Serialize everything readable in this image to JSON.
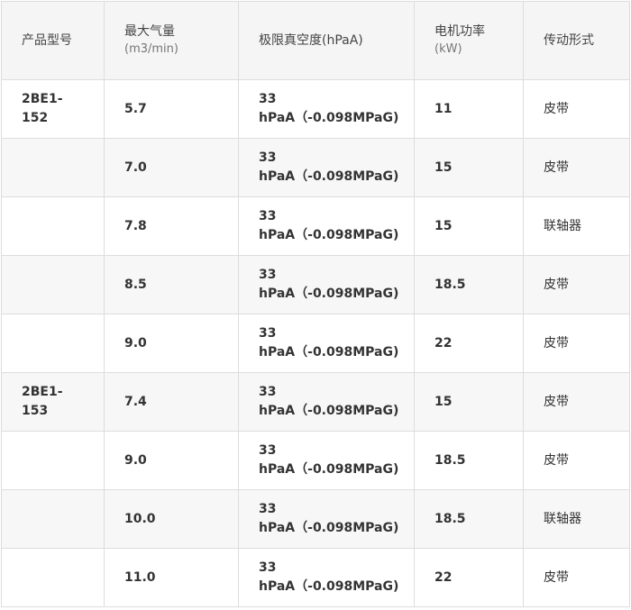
{
  "headers": {
    "model": "产品型号",
    "airflow": "最大气量",
    "airflow_unit": "(m3/min)",
    "vacuum": "极限真空度(hPaA)",
    "power": "电机功率",
    "power_unit": "(kW)",
    "drive": "传动形式"
  },
  "rows": [
    {
      "model": "2BE1-152",
      "airflow": "5.7",
      "vacuum_1": "33",
      "vacuum_2": "hPaA（-0.098MPaG)",
      "power": "11",
      "drive": "皮带"
    },
    {
      "model": "",
      "airflow": "7.0",
      "vacuum_1": "33",
      "vacuum_2": "hPaA（-0.098MPaG)",
      "power": "15",
      "drive": "皮带"
    },
    {
      "model": "",
      "airflow": "7.8",
      "vacuum_1": "33",
      "vacuum_2": "hPaA（-0.098MPaG)",
      "power": "15",
      "drive": "联轴器"
    },
    {
      "model": "",
      "airflow": "8.5",
      "vacuum_1": "33",
      "vacuum_2": "hPaA（-0.098MPaG)",
      "power": "18.5",
      "drive": "皮带"
    },
    {
      "model": "",
      "airflow": "9.0",
      "vacuum_1": "33",
      "vacuum_2": "hPaA（-0.098MPaG)",
      "power": "22",
      "drive": "皮带"
    },
    {
      "model": "2BE1-153",
      "airflow": "7.4",
      "vacuum_1": "33",
      "vacuum_2": "hPaA（-0.098MPaG)",
      "power": "15",
      "drive": "皮带"
    },
    {
      "model": "",
      "airflow": "9.0",
      "vacuum_1": "33",
      "vacuum_2": "hPaA（-0.098MPaG)",
      "power": "18.5",
      "drive": "皮带"
    },
    {
      "model": "",
      "airflow": "10.0",
      "vacuum_1": "33",
      "vacuum_2": "hPaA（-0.098MPaG)",
      "power": "18.5",
      "drive": "联轴器"
    },
    {
      "model": "",
      "airflow": "11.0",
      "vacuum_1": "33",
      "vacuum_2": "hPaA（-0.098MPaG)",
      "power": "22",
      "drive": "皮带"
    }
  ]
}
